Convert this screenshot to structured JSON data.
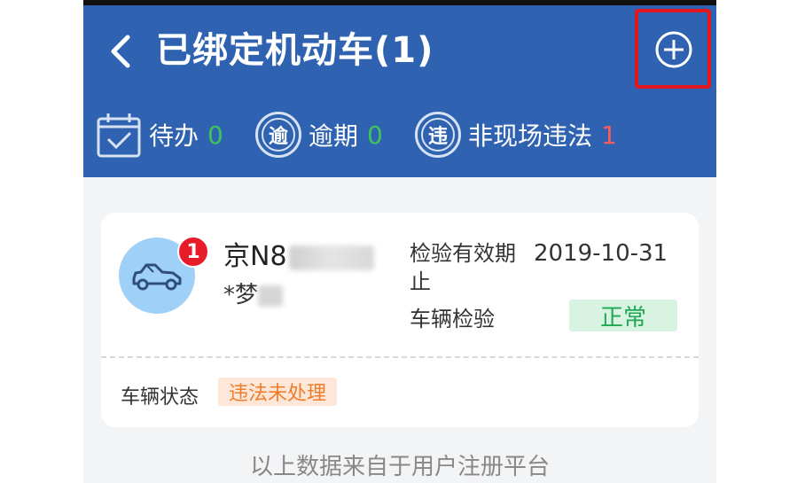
{
  "header": {
    "title": "已绑定机动车(1)",
    "back_icon": "chevron-left-icon",
    "add_icon": "plus-circle-icon"
  },
  "stats": [
    {
      "label": "待办",
      "count": "0",
      "icon": "calendar-check-icon"
    },
    {
      "label": "逾期",
      "count": "0",
      "icon_text": "逾",
      "icon": "overdue-icon"
    },
    {
      "label": "非现场违法",
      "count": "1",
      "icon_text": "违",
      "icon": "violation-icon"
    }
  ],
  "vehicle": {
    "notification_count": "1",
    "plate_visible": "京N8",
    "owner_prefix": "*梦",
    "inspection_label": "检验有效期止",
    "inspection_date": "2019-10-31",
    "vehicle_check_label": "车辆检验",
    "vehicle_check_status": "正常",
    "state_label": "车辆状态",
    "state_value": "违法未处理",
    "car_icon": "car-icon"
  },
  "footer": {
    "note": "以上数据来自于用户注册平台"
  },
  "colors": {
    "header_bg": "#2f63b2",
    "count_green": "#3fc45a",
    "count_red": "#ff5a5a",
    "badge_red": "#e81b2a",
    "highlight_box": "#e3171d",
    "status_ok_bg": "#d9f3e2",
    "status_ok_text": "#1fa852",
    "state_tag_bg": "#fde7d8",
    "state_tag_text": "#f07d2b"
  }
}
